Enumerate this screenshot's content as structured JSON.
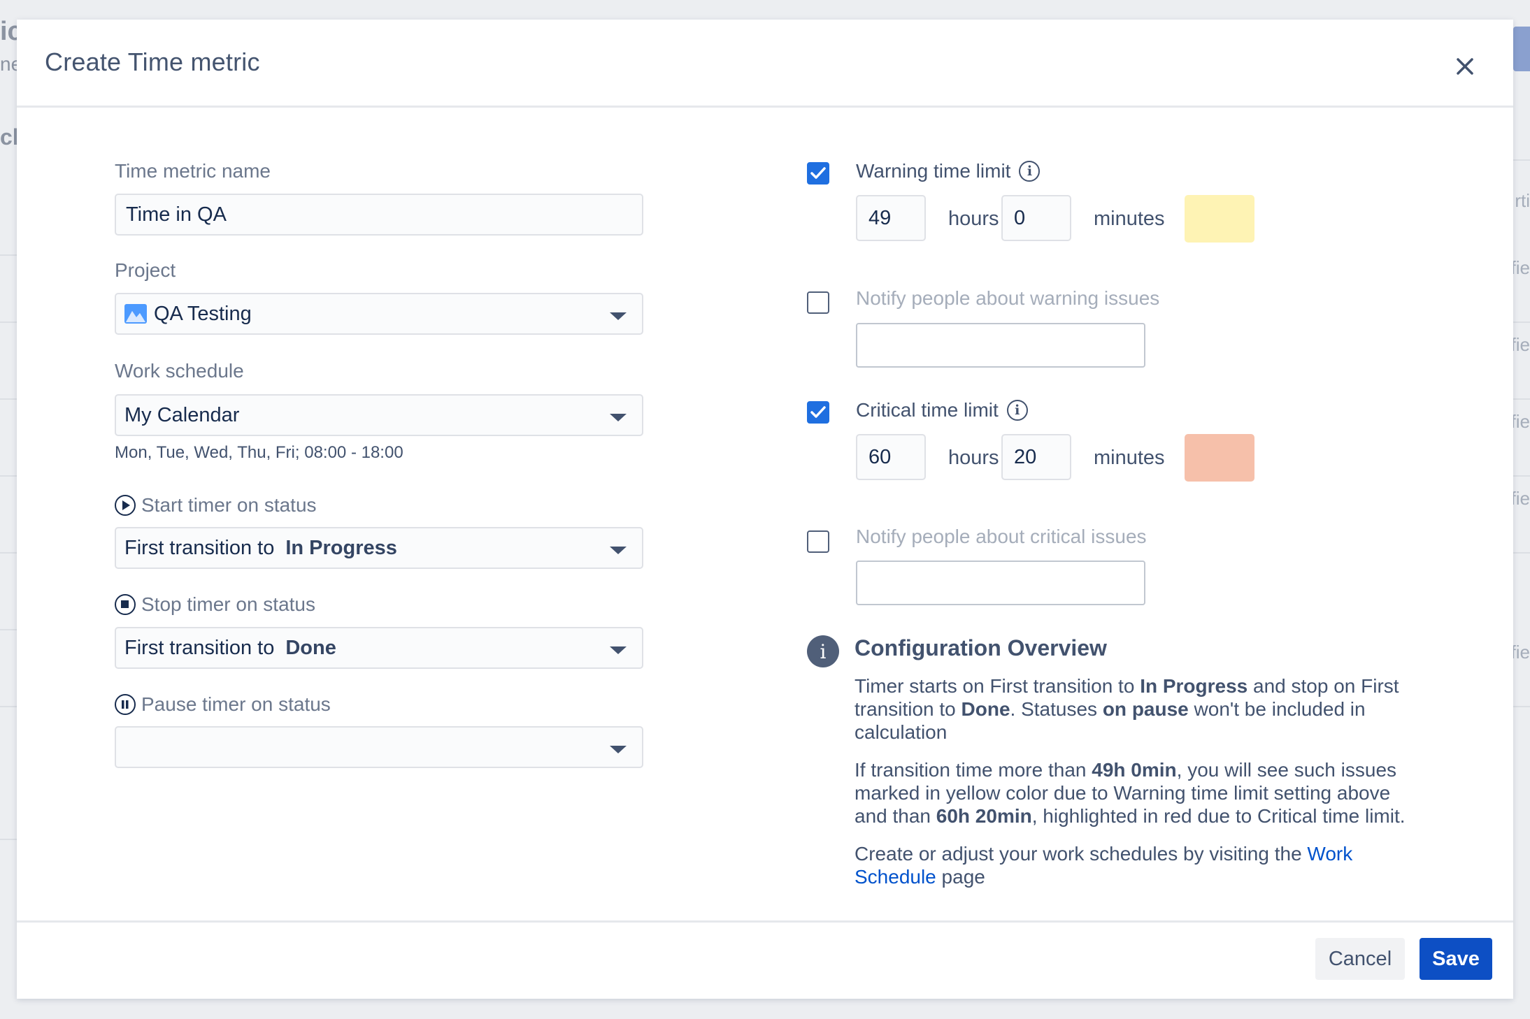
{
  "background": {
    "frag_top": "ic",
    "frag_sub": "ne",
    "frag_mid": "cl",
    "frag_right_1": "rti",
    "frag_right_2": "fie",
    "frag_right_3": "fie",
    "frag_right_4": "fie",
    "frag_right_5": "fie",
    "frag_right_6": "fie"
  },
  "modal": {
    "title": "Create Time metric"
  },
  "form": {
    "name_label": "Time metric name",
    "name_value": "Time in QA",
    "project_label": "Project",
    "project_value": "QA Testing",
    "schedule_label": "Work schedule",
    "schedule_value": "My Calendar",
    "schedule_helper": "Mon, Tue, Wed, Thu, Fri; 08:00 - 18:00",
    "start_label": "Start timer on status",
    "start_prefix": "First transition to",
    "start_status": "In Progress",
    "stop_label": "Stop timer on status",
    "stop_prefix": "First transition to",
    "stop_status": "Done",
    "pause_label": "Pause timer on status",
    "pause_value": ""
  },
  "limits": {
    "warning_label": "Warning time limit",
    "warning_checked": true,
    "warning_hours": "49",
    "warning_minutes": "0",
    "warning_color": "#fef3b4",
    "hours_unit": "hours",
    "minutes_unit": "minutes",
    "notify_warning_label": "Notify people about warning issues",
    "notify_warning_checked": false,
    "critical_label": "Critical time limit",
    "critical_checked": true,
    "critical_hours": "60",
    "critical_minutes": "20",
    "critical_color": "#f6c0aa",
    "notify_critical_label": "Notify people about critical issues",
    "notify_critical_checked": false
  },
  "overview": {
    "title": "Configuration Overview",
    "p1_a": "Timer starts on First transition to ",
    "p1_b": "In Progress",
    "p1_c": " and stop on First transition to ",
    "p1_d": "Done",
    "p1_e": ". Statuses ",
    "p1_f": "on pause",
    "p1_g": " won't be included in calculation",
    "p2_a": "If transition time more than ",
    "p2_b": "49h 0min",
    "p2_c": ", you will see such issues marked in yellow color due to Warning time limit setting above and than ",
    "p2_d": "60h 20min",
    "p2_e": ", highlighted in red due to Critical time limit.",
    "p3_a": "Create or adjust your work schedules by visiting the ",
    "p3_link": "Work Schedule",
    "p3_b": " page"
  },
  "footer": {
    "cancel_label": "Cancel",
    "save_label": "Save"
  }
}
